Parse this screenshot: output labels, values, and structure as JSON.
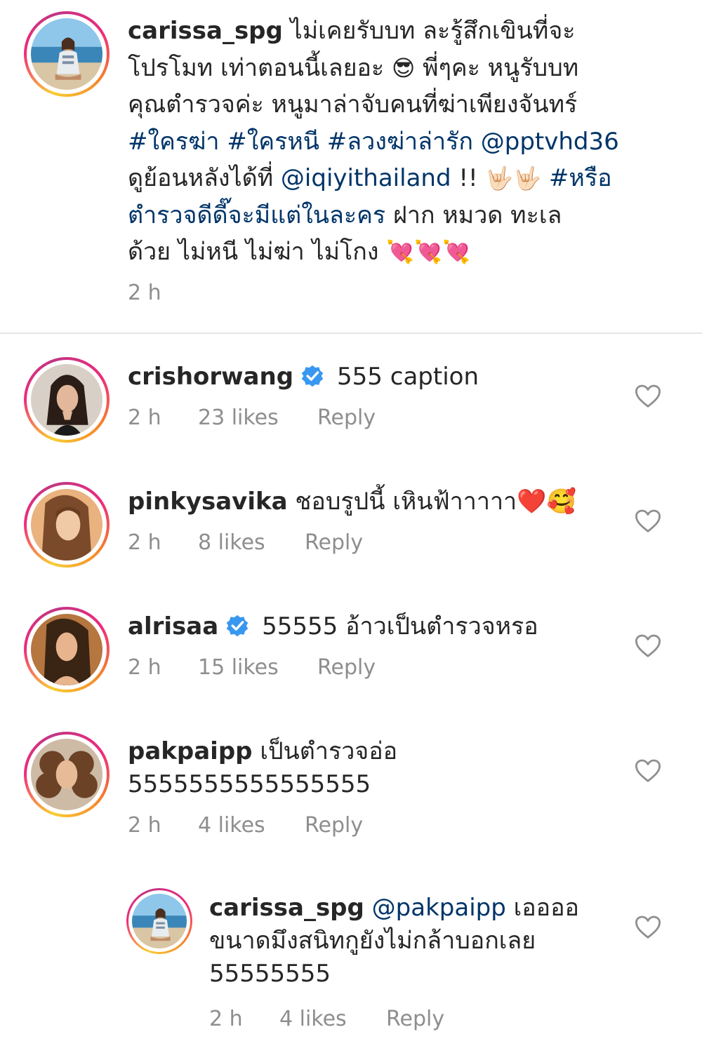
{
  "post": {
    "username": "carissa_spg",
    "caption_lines": [
      "ไม่เคยรับบท ละรู้สึกเขินที่จะ",
      "โปรโมท เท่าตอนนี้เลยอะ",
      "พี่ๆคะ หนูรับบท",
      "คุณตำรวจค่ะ หนูมาล่าจับคนที่ฆ่าเพียงจันทร์",
      "#ใครฆ่า",
      "#ใครหนี",
      "#ลวงฆ่าล่ารัก",
      "@pptvhd36",
      "ดูย้อนหลังได้ที่",
      "@iqiyithailand",
      " !! ",
      "#หรือ",
      "ตำรวจดีดี๊จะมีแต่ในละคร",
      " ฝาก หมวด ทะเล",
      "ด้วย ไม่หนี ไม่ฆ่า ไม่โกง "
    ],
    "emoji_cool": "😎",
    "emoji_rock": "🤟🏻🤟🏻",
    "emoji_hearts": "💘💘💘",
    "time": "2 h"
  },
  "comments": [
    {
      "username": "crishorwang",
      "verified": true,
      "text": "555 caption",
      "time": "2 h",
      "likes": "23 likes",
      "reply": "Reply"
    },
    {
      "username": "pinkysavika",
      "verified": false,
      "text": "ชอบรูปนี้ เหินฟ้าาาาา❤️🥰",
      "time": "2 h",
      "likes": "8 likes",
      "reply": "Reply"
    },
    {
      "username": "alrisaa",
      "verified": true,
      "text": "55555 อ้าวเป็นตำรวจหรอ",
      "time": "2 h",
      "likes": "15 likes",
      "reply": "Reply"
    },
    {
      "username": "pakpaipp",
      "verified": false,
      "text": "เป็นตำรวจอ่อ",
      "text_line2": "5555555555555555",
      "time": "2 h",
      "likes": "4 likes",
      "reply": "Reply"
    }
  ],
  "reply": {
    "username": "carissa_spg",
    "mention": "@pakpaipp",
    "text_line1": " เออออ",
    "text_line2": "ขนาดมึงสนิทกูยังไม่กล้าบอกเลย",
    "text_line3": "55555555",
    "time": "2 h",
    "likes": "4 likes",
    "reply": "Reply"
  },
  "icons": {
    "verified": "verified-badge-icon",
    "like": "heart-outline-icon"
  },
  "colors": {
    "link": "#003569",
    "meta": "#8e8e8e",
    "verified": "#3897f0",
    "text": "#262626"
  }
}
